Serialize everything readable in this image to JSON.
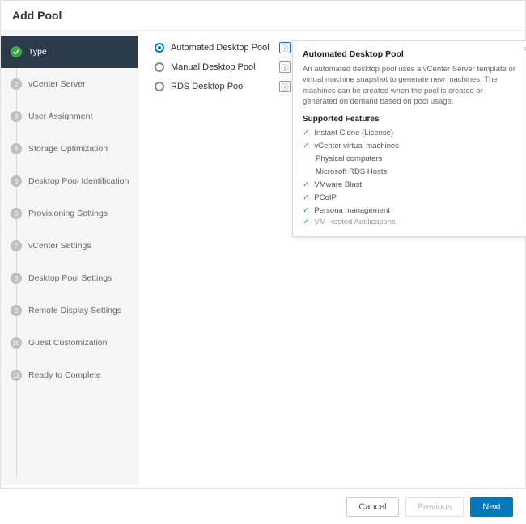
{
  "header": {
    "title": "Add Pool"
  },
  "sidebar": {
    "steps": [
      {
        "label": "Type"
      },
      {
        "label": "vCenter Server"
      },
      {
        "label": "User Assignment"
      },
      {
        "label": "Storage Optimization"
      },
      {
        "label": "Desktop Pool Identification"
      },
      {
        "label": "Provisioning Settings"
      },
      {
        "label": "vCenter Settings"
      },
      {
        "label": "Desktop Pool Settings"
      },
      {
        "label": "Remote Display Settings"
      },
      {
        "label": "Guest Customization"
      },
      {
        "label": "Ready to Complete"
      }
    ]
  },
  "options": [
    {
      "label": "Automated Desktop Pool",
      "selected": true
    },
    {
      "label": "Manual Desktop Pool",
      "selected": false
    },
    {
      "label": "RDS Desktop Pool",
      "selected": false
    }
  ],
  "tooltip": {
    "title": "Automated Desktop Pool",
    "description": "An automated desktop pool uses a vCenter Server template or virtual machine snapshot to generate new machines. The machines can be created when the pool is created or generated on demand based on pool usage.",
    "features_title": "Supported Features",
    "features": [
      {
        "label": "Instant Clone (License)",
        "check": true
      },
      {
        "label": "vCenter virtual machines",
        "check": true
      },
      {
        "label": "Physical computers",
        "check": false
      },
      {
        "label": "Microsoft RDS Hosts",
        "check": false
      },
      {
        "label": "VMware Blast",
        "check": true
      },
      {
        "label": "PCoIP",
        "check": true
      },
      {
        "label": "Persona management",
        "check": true
      },
      {
        "label": "VM Hosted Applications",
        "check": true,
        "cut": true
      }
    ]
  },
  "footer": {
    "cancel": "Cancel",
    "previous": "Previous",
    "next": "Next"
  }
}
